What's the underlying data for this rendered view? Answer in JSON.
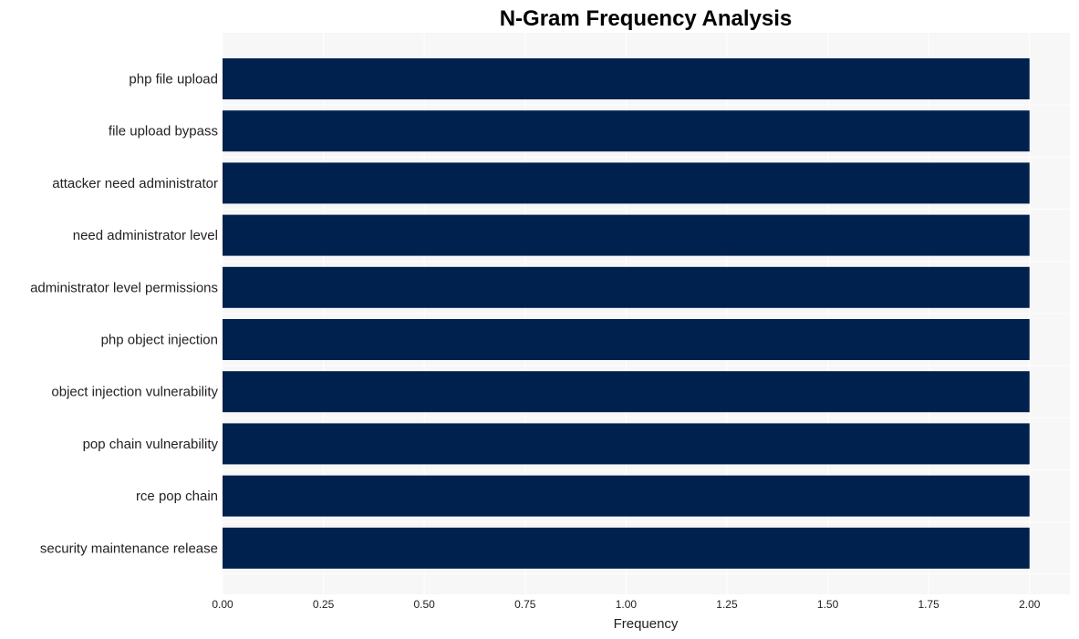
{
  "chart_data": {
    "type": "bar",
    "orientation": "horizontal",
    "title": "N-Gram Frequency Analysis",
    "xlabel": "Frequency",
    "ylabel": "",
    "categories": [
      "php file upload",
      "file upload bypass",
      "attacker need administrator",
      "need administrator level",
      "administrator level permissions",
      "php object injection",
      "object injection vulnerability",
      "pop chain vulnerability",
      "rce pop chain",
      "security maintenance release"
    ],
    "values": [
      2,
      2,
      2,
      2,
      2,
      2,
      2,
      2,
      2,
      2
    ],
    "xlim": [
      0,
      2.1
    ],
    "xticks": [
      "0.00",
      "0.25",
      "0.50",
      "0.75",
      "1.00",
      "1.25",
      "1.50",
      "1.75",
      "2.00"
    ],
    "grid": true,
    "legend": "none",
    "colors": {
      "bar": "#00214e",
      "plot_background": "#f7f7f7",
      "grid": "#ffffff"
    }
  }
}
